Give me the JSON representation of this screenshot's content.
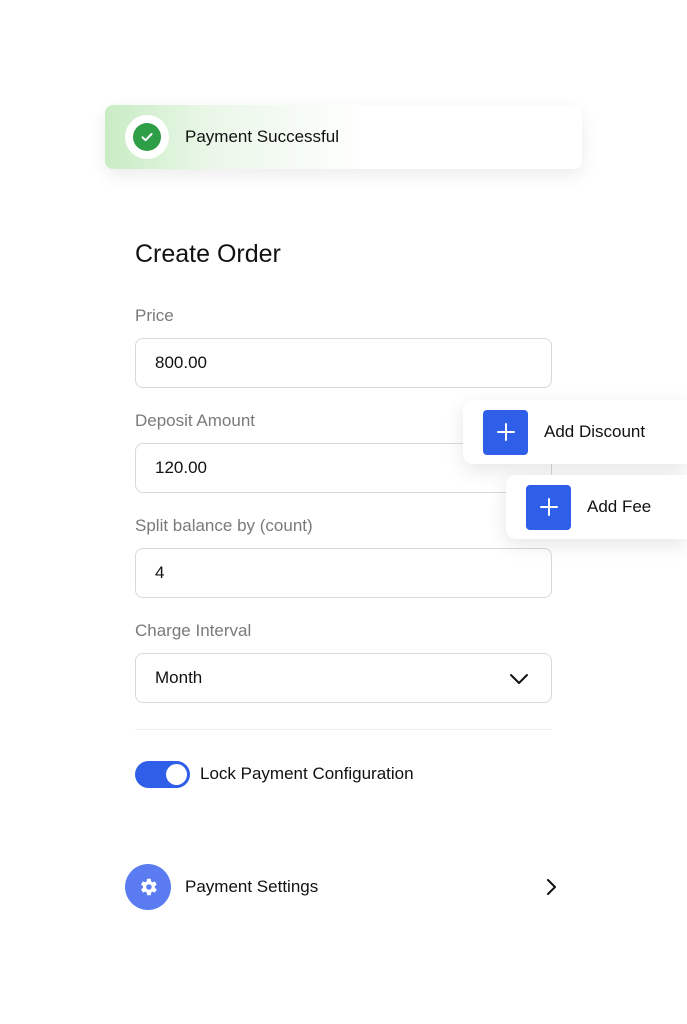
{
  "toast": {
    "message": "Payment Successful",
    "accent": "#2e9e47"
  },
  "form": {
    "title": "Create Order",
    "price": {
      "label": "Price",
      "value": "800.00"
    },
    "deposit": {
      "label": "Deposit Amount",
      "value": "120.00"
    },
    "split": {
      "label": "Split balance by (count)",
      "value": "4"
    },
    "interval": {
      "label": "Charge Interval",
      "selected": "Month"
    }
  },
  "lock_toggle": {
    "label": "Lock Payment Configuration",
    "on": true
  },
  "settings": {
    "label": "Payment Settings"
  },
  "actions": {
    "add_discount": "Add Discount",
    "add_fee": "Add Fee"
  },
  "colors": {
    "primary": "#2f5fe8",
    "settings_icon_bg": "#5a7cf0"
  }
}
